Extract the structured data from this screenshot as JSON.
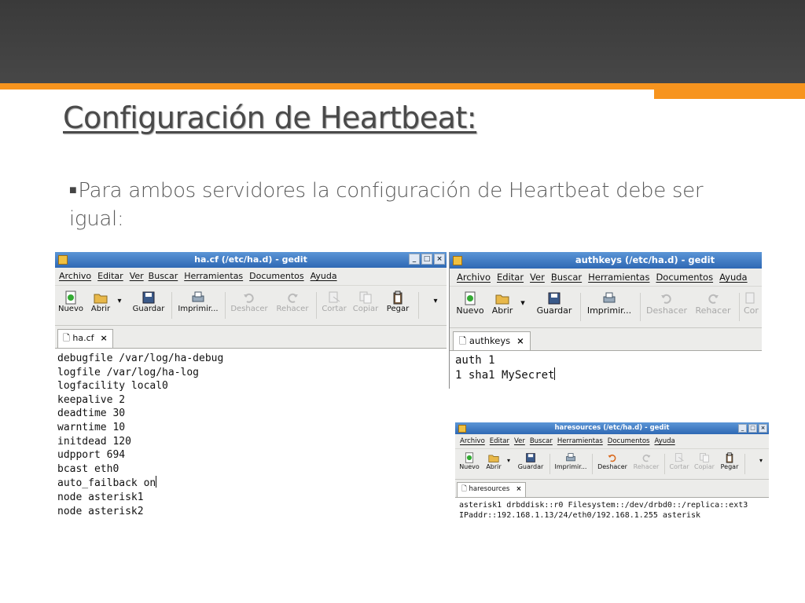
{
  "slide": {
    "title": "Configuración de Heartbeat:",
    "bullet": "Para ambos  servidores la configuración de Heartbeat debe ser igual:",
    "accent_color": "#f7941e",
    "header_color": "#414141"
  },
  "menu": [
    "Archivo",
    "Editar",
    "Ver",
    "Buscar",
    "Herramientas",
    "Documentos",
    "Ayuda"
  ],
  "toolbar": {
    "nuevo": "Nuevo",
    "abrir": "Abrir",
    "guardar": "Guardar",
    "imprimir": "Imprimir...",
    "deshacer": "Deshacer",
    "rehacer": "Rehacer",
    "cortar": "Cortar",
    "copiar": "Copiar",
    "pegar": "Pegar",
    "cortar_truncated": "Cor"
  },
  "windows": {
    "hacf": {
      "title": "ha.cf (/etc/ha.d) - gedit",
      "tab": "ha.cf",
      "lines": [
        "debugfile /var/log/ha-debug",
        "logfile /var/log/ha-log",
        "logfacility local0",
        "keepalive 2",
        "deadtime 30",
        "warntime 10",
        "initdead 120",
        "udpport 694",
        "bcast eth0",
        "auto_failback on",
        "node asterisk1",
        "node asterisk2"
      ]
    },
    "authkeys": {
      "title": "authkeys (/etc/ha.d) - gedit",
      "tab": "authkeys",
      "lines": [
        "auth 1",
        "1 sha1 MySecret"
      ]
    },
    "haresources": {
      "title": "haresources (/etc/ha.d) - gedit",
      "tab": "haresources",
      "lines": [
        "asterisk1 drbddisk::r0 Filesystem::/dev/drbd0::/replica::ext3",
        "IPaddr::192.168.1.13/24/eth0/192.168.1.255 asterisk"
      ]
    }
  }
}
